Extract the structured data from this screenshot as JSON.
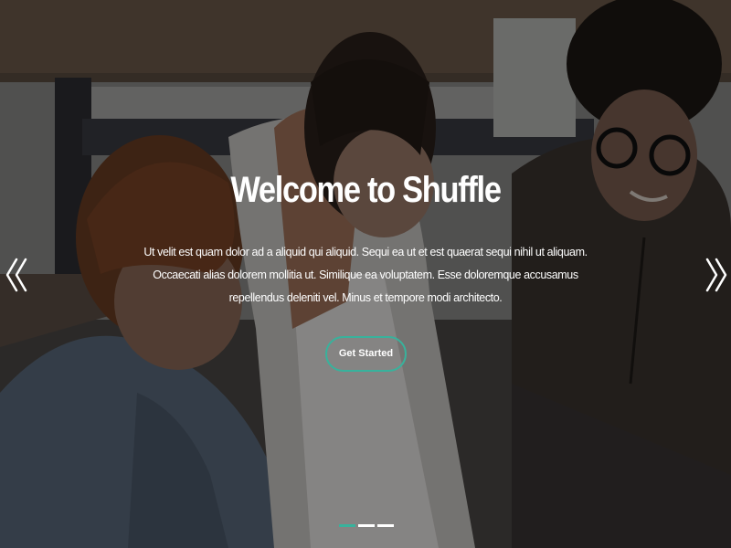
{
  "hero": {
    "title": "Welcome to Shuffle",
    "description": "Ut velit est quam dolor ad a aliquid qui aliquid. Sequi ea ut et est quaerat sequi nihil ut aliquam. Occaecati alias dolorem mollitia ut. Similique ea voluptatem. Esse doloremque accusamus repellendus deleniti vel. Minus et tempore modi architecto.",
    "cta_label": "Get Started"
  },
  "carousel": {
    "prev_icon": "chevron-double-left-icon",
    "next_icon": "chevron-double-right-icon",
    "slide_count": 3,
    "active_slide": 1
  },
  "colors": {
    "accent": "#38b29c",
    "text": "#ffffff"
  }
}
